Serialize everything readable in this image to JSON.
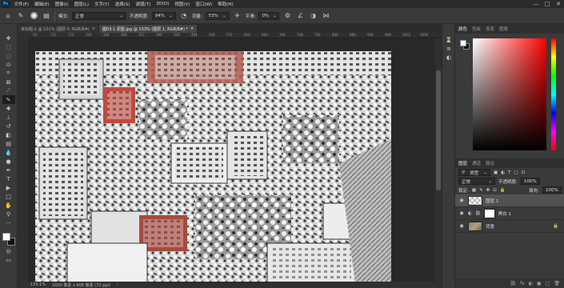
{
  "menubar": {
    "logo": "Ps",
    "items": [
      "文件(F)",
      "编辑(E)",
      "图像(I)",
      "图层(L)",
      "文字(Y)",
      "选择(S)",
      "滤镜(T)",
      "3D(D)",
      "视图(V)",
      "窗口(W)",
      "帮助(H)"
    ],
    "window_controls": [
      "—",
      "□",
      "✕"
    ]
  },
  "options": {
    "mode_label": "模式:",
    "mode_value": "正常",
    "opacity_label": "不透明度:",
    "opacity_value": "94%",
    "flow_label": "流量:",
    "flow_value": "53%",
    "smoothing_label": "平滑:",
    "smoothing_value": "0%"
  },
  "tabs": [
    {
      "label": "未标题-2 @ 101% (图层 0, RGB/8#)",
      "close": "×",
      "active": false
    },
    {
      "label": "图03-1 原图.jpg @ 133% (图层 1, RGB/8#) *",
      "close": "×",
      "active": true
    }
  ],
  "ruler_labels": [
    "54",
    "132",
    "176",
    "220",
    "264",
    "308",
    "352",
    "396",
    "440",
    "484",
    "528",
    "572",
    "616",
    "660",
    "704",
    "748",
    "792",
    "836",
    "880",
    "924",
    "968",
    "1012",
    "1056"
  ],
  "statusbar": {
    "zoom": "133.1%",
    "doc_size": "1000 像素 x 606 像素 (72 ppi)",
    "arrow": "›"
  },
  "color_panel": {
    "tabs": [
      "颜色",
      "色板",
      "渐变",
      "图案"
    ],
    "accent": "#ff0000"
  },
  "layers_panel": {
    "tabs": [
      "图层",
      "通道",
      "路径"
    ],
    "kind_label": "类型",
    "blend_mode": "正常",
    "opacity_label": "不透明度:",
    "opacity_value": "100%",
    "lock_label": "锁定:",
    "fill_label": "填充:",
    "fill_value": "100%",
    "layers": [
      {
        "name": "图层 1",
        "selected": true
      },
      {
        "name": "黑白 1",
        "selected": false
      },
      {
        "name": "背景",
        "selected": false
      }
    ],
    "bottom_icons": [
      "fx",
      "◐",
      "▣",
      "▢",
      "🗑"
    ]
  }
}
